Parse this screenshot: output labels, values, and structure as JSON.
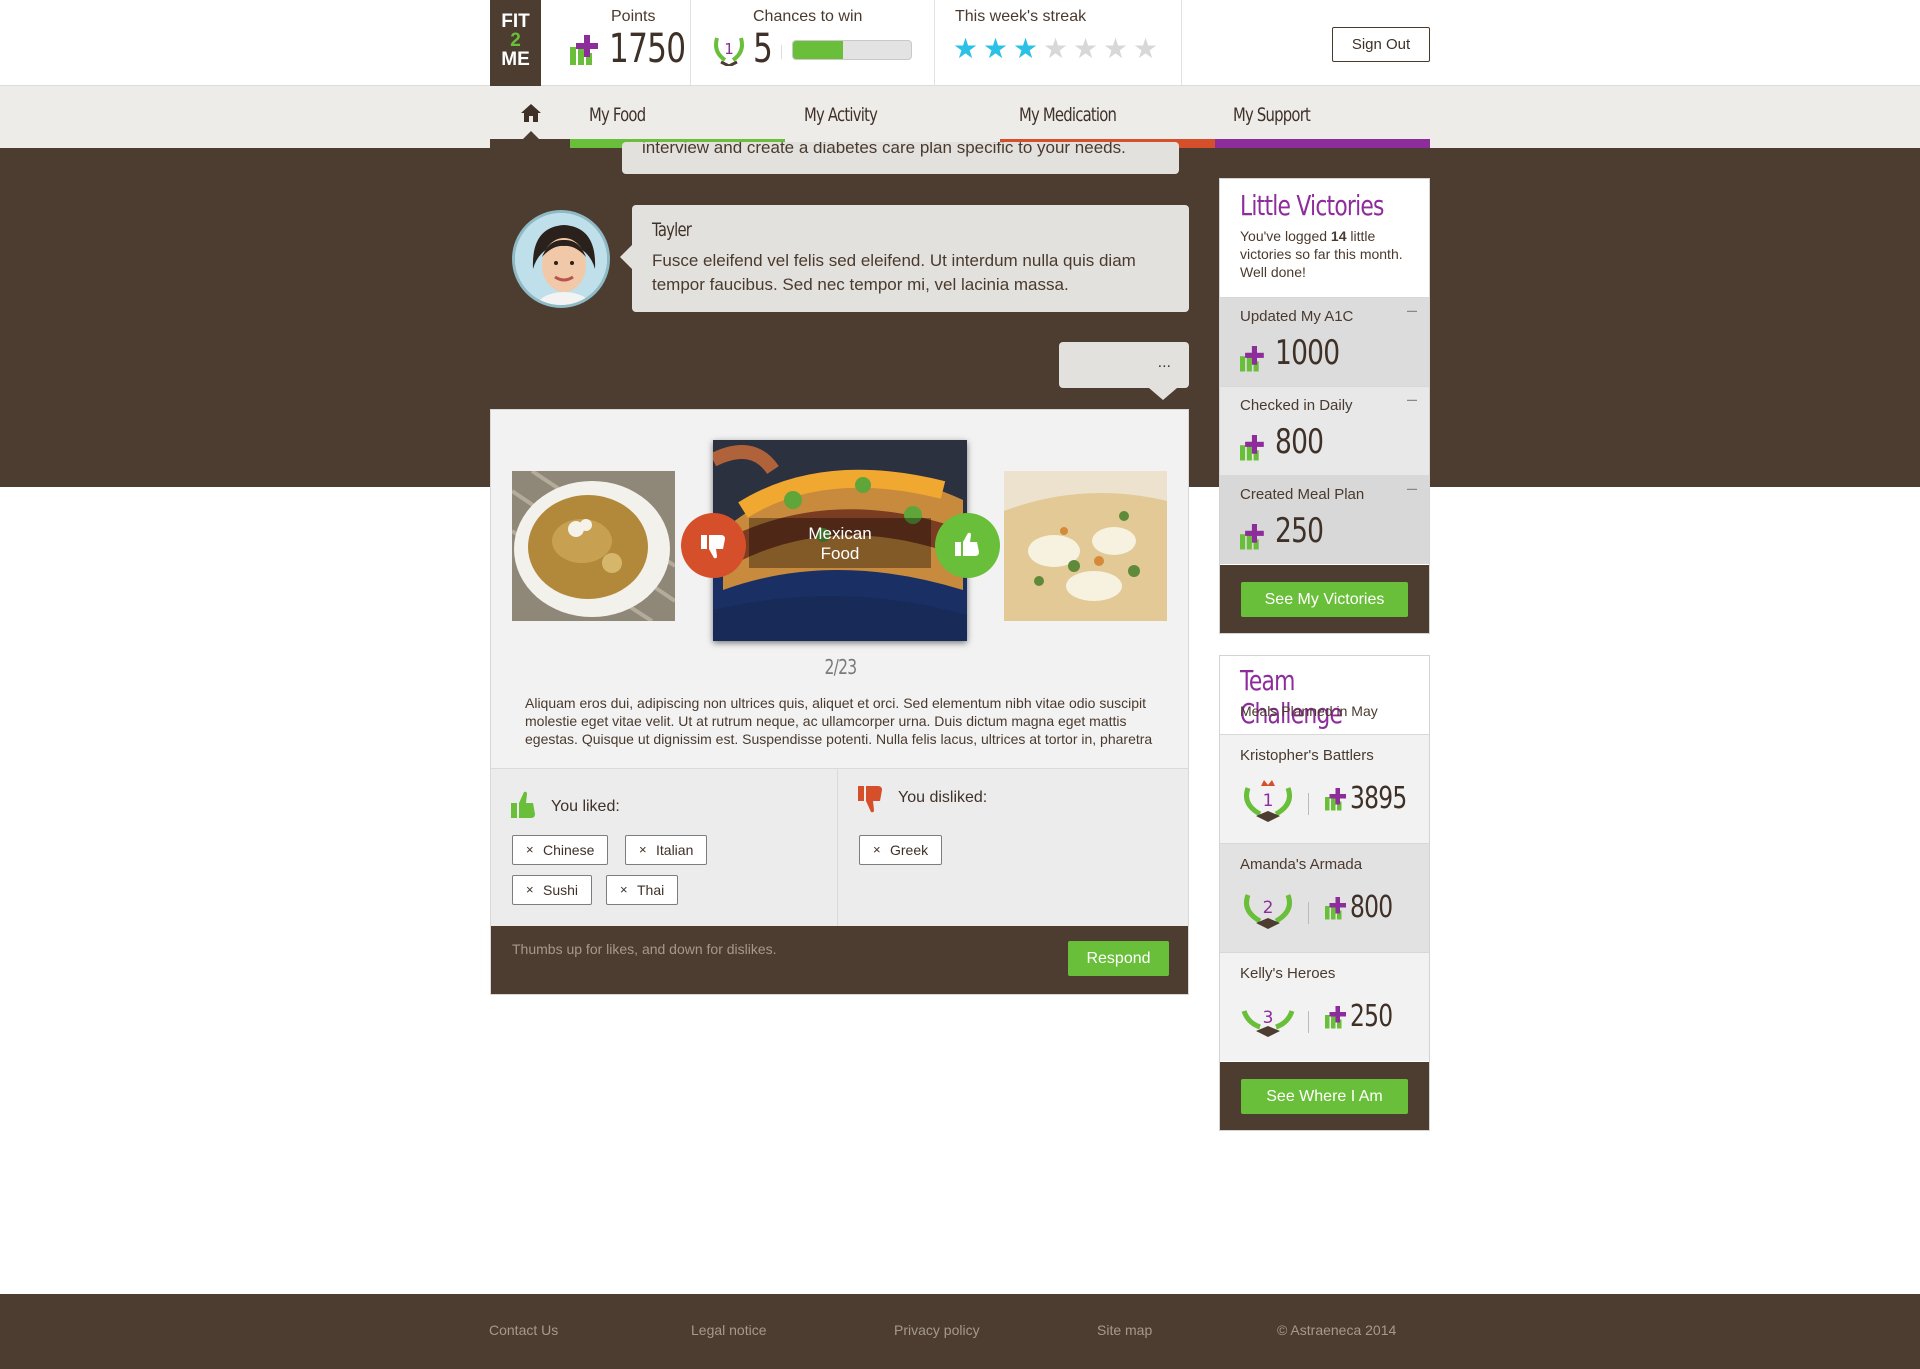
{
  "header": {
    "logo": {
      "line1": "FIT",
      "line2": "2",
      "line3": "ME"
    },
    "points": {
      "label": "Points",
      "value": "1750",
      "icon": "points-plus-icon"
    },
    "chances": {
      "label": "Chances to win",
      "value": "5",
      "progress_fraction": 0.42,
      "icon": "rank-wreath-icon"
    },
    "streak": {
      "label": "This week's streak",
      "filled_stars": 3,
      "total_stars": 7
    },
    "sign_out": "Sign Out"
  },
  "nav": {
    "home_icon": "home-icon",
    "items": [
      {
        "label": "My Food",
        "color": "#6abf3a"
      },
      {
        "label": "My Activity",
        "color": "#eeece9"
      },
      {
        "label": "My Medication",
        "color": "#d5502a"
      },
      {
        "label": "My Support",
        "color": "#8d2c9b"
      }
    ]
  },
  "chat": {
    "previous_message": "interview and create a diabetes care plan specific to your needs.",
    "sender": "Tayler",
    "message": "Fusce eleifend vel felis sed eleifend. Ut interdum nulla quis diam tempor faucibus. Sed nec tempor mi, vel lacinia massa.",
    "typing": "..."
  },
  "food_card": {
    "current_label_line1": "Mexican",
    "current_label_line2": "Food",
    "counter": "2/23",
    "description": "Aliquam eros dui, adipiscing non ultrices quis, aliquet et orci. Sed elementum nibh vitae odio suscipit molestie eget vitae velit. Ut at rutrum neque, ac ullamcorper urna. Duis dictum magna eget mattis egestas. Quisque ut dignissim est. Suspendisse potenti. Nulla felis lacus, ultrices at tortor in, pharetra",
    "liked_title": "You liked:",
    "liked": [
      "Chinese",
      "Italian",
      "Sushi",
      "Thai"
    ],
    "disliked_title": "You disliked:",
    "disliked": [
      "Greek"
    ],
    "tag_remove": "×",
    "hint": "Thumbs up for likes, and down for dislikes.",
    "respond": "Respond"
  },
  "victories": {
    "title": "Little Victories",
    "sub_pre": "You've logged ",
    "sub_count": "14",
    "sub_post": " little victories so far this month. Well done!",
    "items": [
      {
        "label": "Updated My A1C",
        "value": "1000"
      },
      {
        "label": "Checked in Daily",
        "value": "800"
      },
      {
        "label": "Created Meal Plan",
        "value": "250"
      }
    ],
    "collapse": "–",
    "button": "See My Victories"
  },
  "team": {
    "title": "Team Challenge",
    "subtitle": "Meals Planned in May",
    "teams": [
      {
        "name": "Kristopher's Battlers",
        "rank": "1",
        "value": "3895"
      },
      {
        "name": "Amanda's Armada",
        "rank": "2",
        "value": "800"
      },
      {
        "name": "Kelly's Heroes",
        "rank": "3",
        "value": "250"
      }
    ],
    "button": "See Where I Am"
  },
  "footer": {
    "links": [
      "Contact Us",
      "Legal notice",
      "Privacy policy",
      "Site map"
    ],
    "copyright": "© Astraeneca 2014"
  },
  "colors": {
    "brown": "#4d3d31",
    "green": "#6abf3a",
    "purple": "#8d2c9b",
    "red": "#d5502a",
    "star": "#2bc1e6"
  }
}
